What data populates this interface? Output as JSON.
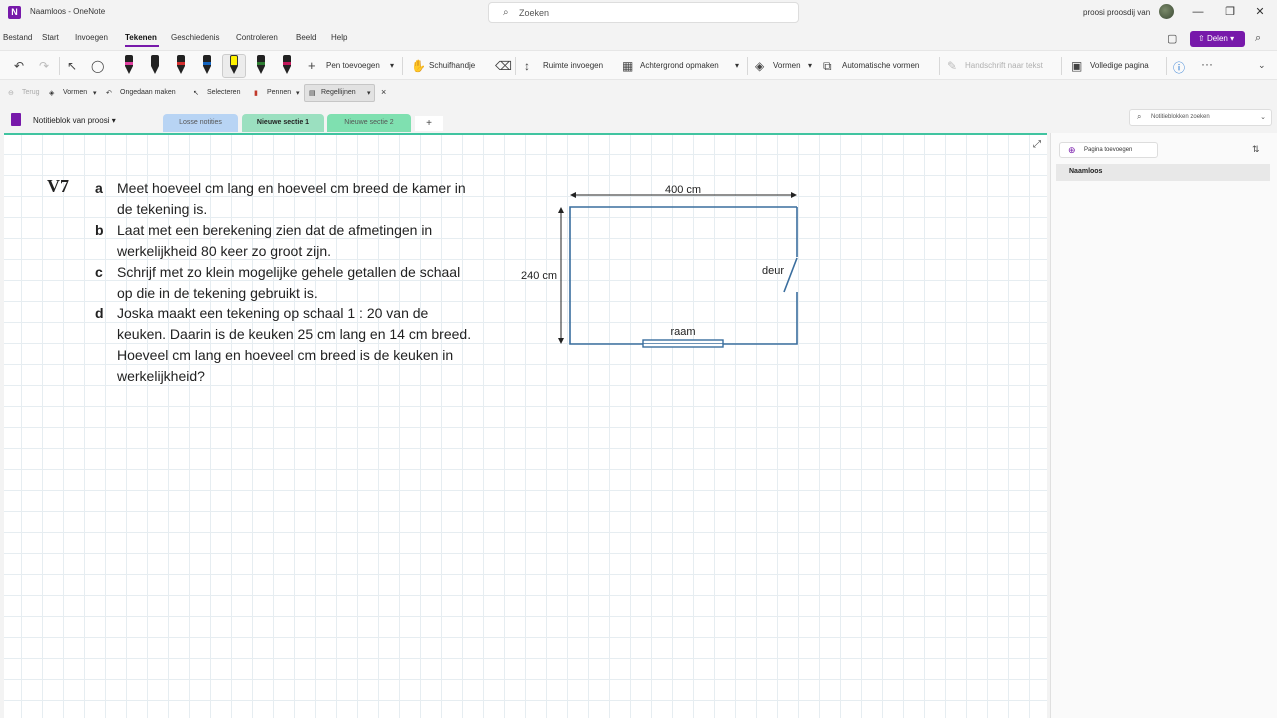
{
  "window": {
    "title": "Naamloos - OneNote",
    "app_letter": "N",
    "search_placeholder": "Zoeken",
    "user_name": "proosi proosdij van",
    "minimize": "—",
    "maximize": "❐",
    "close": "✕"
  },
  "menu": {
    "items": [
      "Bestand",
      "Start",
      "Invoegen",
      "Tekenen",
      "Geschiedenis",
      "Controleren",
      "Beeld",
      "Help"
    ],
    "share_label": "Delen"
  },
  "ribbon": {
    "undo": "↶",
    "redo": "↷",
    "select": "↖",
    "lasso": "◯",
    "pen_colors": [
      "#e040a0",
      "#222222",
      "#d32f2f",
      "#1565c0",
      "#fff200",
      "#2e7d32",
      "#c2185b"
    ],
    "add_pen": "Pen toevoegen",
    "hand": "Schuifhandje",
    "ruimte": "Ruimte invoegen",
    "achtergrond": "Achtergrond opmaken",
    "vormen": "Vormen",
    "auto_vormen": "Automatische vormen",
    "handschrift": "Handschrift naar tekst",
    "volledig": "Volledige pagina",
    "more": "···"
  },
  "toolbar2": {
    "terug": "Terug",
    "vormen": "Vormen",
    "ongedaan": "Ongedaan maken",
    "selecteren": "Selecteren",
    "pennen": "Pennen",
    "regellijnen": "Regellijnen",
    "close": "×"
  },
  "sections": {
    "notebook": "Notitieblok van proosi",
    "tabs": [
      {
        "label": "Losse notities",
        "color": "#b8d4f4"
      },
      {
        "label": "Nieuwe sectie 1",
        "color": "#9be0c0"
      },
      {
        "label": "Nieuwe sectie 2",
        "color": "#7fe0b0"
      }
    ],
    "add": "+",
    "search_placeholder": "Notitieblokken zoeken"
  },
  "exercise": {
    "number": "V7",
    "a_letter": "a",
    "a_line1": "Meet hoeveel cm lang en hoeveel cm breed de kamer in",
    "a_line2": "de tekening is.",
    "b_letter": "b",
    "b_line1": "Laat met een berekening zien dat de afmetingen in",
    "b_line2": "werkelijkheid 80 keer zo groot zijn.",
    "c_letter": "c",
    "c_line1": "Schrijf met zo klein mogelijke gehele getallen de schaal",
    "c_line2": "op die in de tekening gebruikt is.",
    "d_letter": "d",
    "d_line1": "Joska maakt een tekening op schaal 1 : 20 van de",
    "d_line2": "keuken. Daarin is de keuken 25 cm lang en 14 cm breed.",
    "d_line3": "Hoeveel cm lang en hoeveel cm breed is de keuken in",
    "d_line4": "werkelijkheid?"
  },
  "floorplan": {
    "width_label": "400 cm",
    "height_label": "240 cm",
    "door_label": "deur",
    "window_label": "raam"
  },
  "side_pane": {
    "add_page": "Pagina toevoegen",
    "page_title": "Naamloos"
  }
}
